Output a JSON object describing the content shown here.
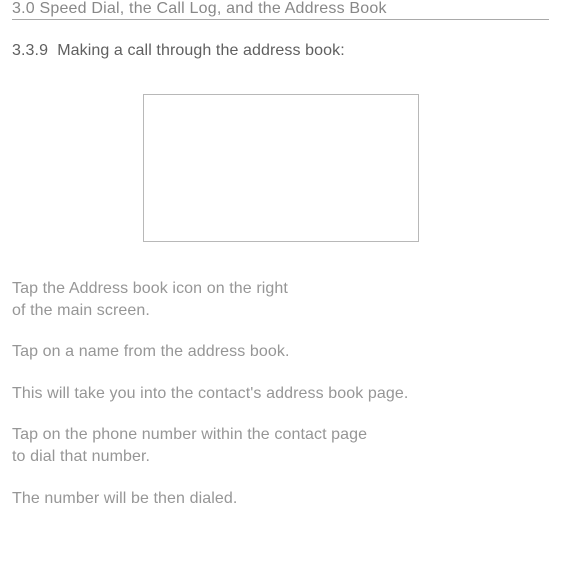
{
  "header": {
    "title": "3.0 Speed Dial, the Call Log, and the Address Book"
  },
  "section": {
    "number": "3.3.9",
    "title": "Making a call through the address book:"
  },
  "body": {
    "p1_l1": "Tap the Address book icon on the right",
    "p1_l2": "of the main screen.",
    "p2": "Tap on a name from the address book.",
    "p3": "This will take you into the contact's address book page.",
    "p4_l1": "Tap on the phone number within the contact page",
    "p4_l2": "to dial that number.",
    "p5": "The number will be then dialed."
  }
}
